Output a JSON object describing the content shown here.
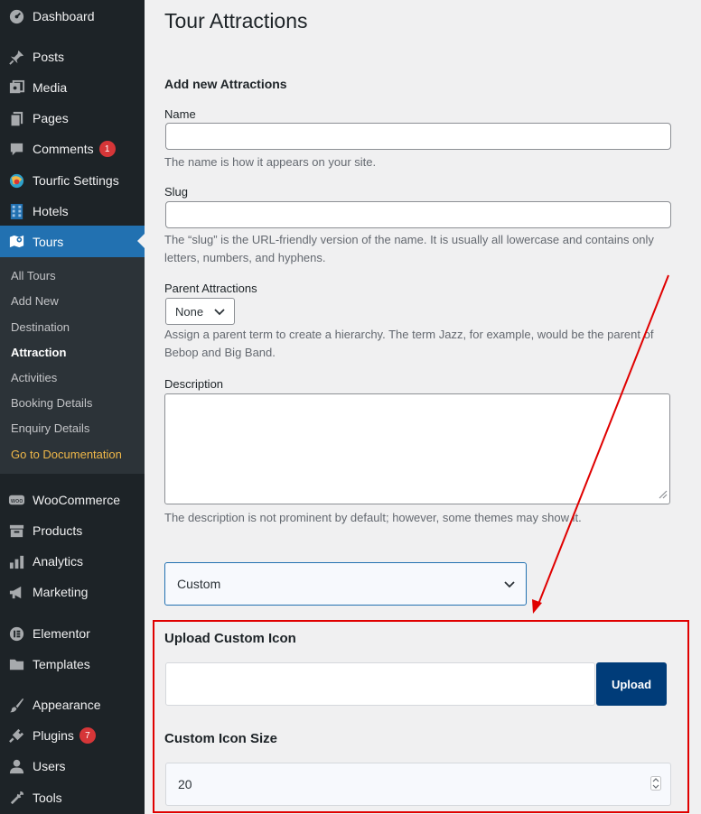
{
  "sidebar": {
    "items": [
      {
        "label": "Dashboard",
        "icon": "dashboard-icon"
      },
      {
        "label": "Posts",
        "icon": "pin-icon"
      },
      {
        "label": "Media",
        "icon": "media-icon"
      },
      {
        "label": "Pages",
        "icon": "pages-icon"
      },
      {
        "label": "Comments",
        "icon": "comment-icon",
        "badge": "1"
      },
      {
        "label": "Tourfic Settings",
        "icon": "tourfic-icon"
      },
      {
        "label": "Hotels",
        "icon": "building-icon"
      },
      {
        "label": "Tours",
        "icon": "map-icon"
      },
      {
        "label": "WooCommerce",
        "icon": "woo-icon"
      },
      {
        "label": "Products",
        "icon": "archive-icon"
      },
      {
        "label": "Analytics",
        "icon": "bar-chart-icon"
      },
      {
        "label": "Marketing",
        "icon": "megaphone-icon"
      },
      {
        "label": "Elementor",
        "icon": "elementor-icon"
      },
      {
        "label": "Templates",
        "icon": "folder-icon"
      },
      {
        "label": "Appearance",
        "icon": "brush-icon"
      },
      {
        "label": "Plugins",
        "icon": "plugin-icon",
        "badge": "7"
      },
      {
        "label": "Users",
        "icon": "users-icon"
      },
      {
        "label": "Tools",
        "icon": "wrench-icon"
      }
    ],
    "submenu": [
      "All Tours",
      "Add New",
      "Destination",
      "Attraction",
      "Activities",
      "Booking Details",
      "Enquiry Details",
      "Go to Documentation"
    ]
  },
  "page": {
    "title": "Tour Attractions",
    "form_title": "Add new Attractions",
    "name_label": "Name",
    "name_help": "The name is how it appears on your site.",
    "slug_label": "Slug",
    "slug_help_1": "The “slug” is the URL-friendly version of the name. It is usually all lowercase and contains only",
    "slug_help_2": "letters, numbers, and hyphens.",
    "parent_label": "Parent Attractions",
    "parent_value": "None",
    "parent_help_1": "Assign a parent term to create a hierarchy. The term Jazz, for example, would be the parent of",
    "parent_help_2": "Bebop and Big Band.",
    "description_label": "Description",
    "description_help": "The description is not prominent by default; however, some themes may show it.",
    "icon_type_value": "Custom",
    "upload_title": "Upload Custom Icon",
    "upload_button": "Upload",
    "size_title": "Custom Icon Size",
    "size_value": "20"
  },
  "colors": {
    "sidebar_bg": "#1d2327",
    "active_bg": "#2271b1",
    "upload_button_bg": "#003c79",
    "highlight": "#e00000"
  }
}
